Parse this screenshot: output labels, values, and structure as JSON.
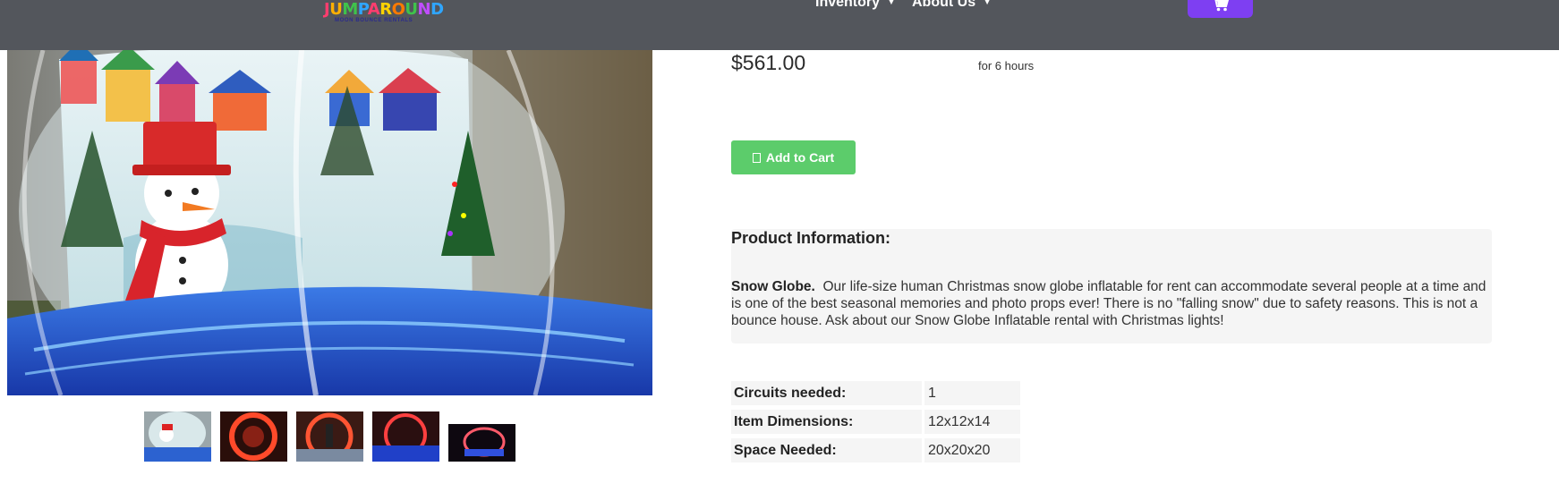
{
  "header": {
    "logo_text": "JUMP AROUND",
    "logo_sub": "MOON BOUNCE RENTALS",
    "nav": [
      {
        "label": "Inventory"
      },
      {
        "label": "About Us"
      }
    ],
    "cart_icon": "shopping-cart-icon",
    "background": "#53565c",
    "accent": "#7e3ff2"
  },
  "product": {
    "price": "$561.00",
    "price_note": "for 6 hours",
    "add_to_cart_label": "Add to Cart",
    "add_to_cart_color": "#5ccc6b",
    "info_title": "Product Information:",
    "desc_lead": "Snow Globe.",
    "desc_body": "Our life-size human Christmas snow globe inflatable for rent can accommodate several people at a time and is one of the best seasonal memories and photo props ever!   There is no \"falling snow\" due to safety reasons. This is not a bounce house. Ask about our Snow Globe Inflatable rental with Christmas lights!",
    "specs": [
      {
        "label": "Circuits needed:",
        "value": "1"
      },
      {
        "label": "Item Dimensions:",
        "value": "12x12x14"
      },
      {
        "label": "Space Needed:",
        "value": "20x20x20"
      }
    ]
  },
  "gallery": {
    "thumbnail_count": 5
  }
}
